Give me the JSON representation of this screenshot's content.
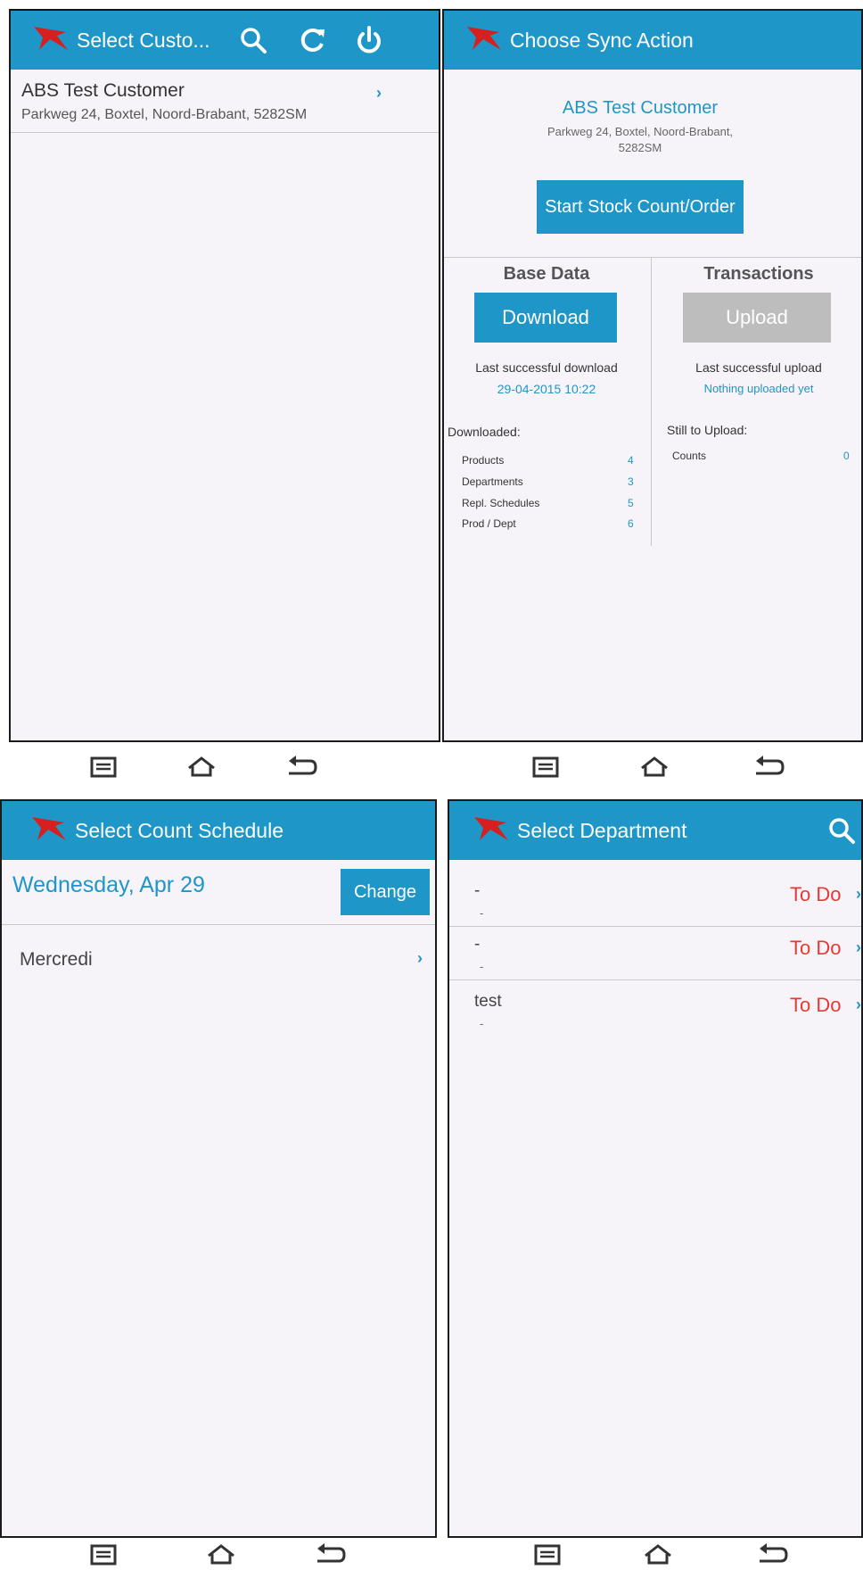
{
  "colors": {
    "accent": "#1e96c8",
    "todo": "#e53935",
    "disabled": "#bdbdbd"
  },
  "screen1": {
    "title": "Select Custo...",
    "icons": [
      "search-icon",
      "refresh-icon",
      "power-icon"
    ],
    "customer": {
      "name": "ABS Test Customer",
      "address": "Parkweg 24, Boxtel, Noord-Brabant, 5282SM",
      "chevron": "›"
    }
  },
  "screen2": {
    "title": "Choose Sync Action",
    "customer_name": "ABS Test Customer",
    "address_line1": "Parkweg 24, Boxtel, Noord-Brabant,",
    "address_line2": "5282SM",
    "start_button": "Start Stock Count/Order",
    "base_data": {
      "heading": "Base Data",
      "button": "Download",
      "last_label": "Last successful download",
      "last_value": "29-04-2015 10:22",
      "list_heading": "Downloaded:",
      "items": [
        {
          "label": "Products",
          "value": "4"
        },
        {
          "label": "Departments",
          "value": "3"
        },
        {
          "label": "Repl. Schedules",
          "value": "5"
        },
        {
          "label": "Prod / Dept",
          "value": "6"
        }
      ]
    },
    "transactions": {
      "heading": "Transactions",
      "button": "Upload",
      "last_label": "Last successful upload",
      "last_value": "Nothing uploaded yet",
      "list_heading": "Still to Upload:",
      "items": [
        {
          "label": "Counts",
          "value": "0"
        }
      ]
    }
  },
  "screen3": {
    "title": "Select Count Schedule",
    "date": "Wednesday, Apr 29",
    "change_button": "Change",
    "schedule": "Mercredi",
    "chevron": "›"
  },
  "screen4": {
    "title": "Select Department",
    "departments": [
      {
        "name": "-",
        "sub": "-",
        "status": "To Do",
        "chevron": "›"
      },
      {
        "name": "-",
        "sub": "-",
        "status": "To Do",
        "chevron": "›"
      },
      {
        "name": "test",
        "sub": "-",
        "status": "To Do",
        "chevron": "›"
      }
    ]
  }
}
